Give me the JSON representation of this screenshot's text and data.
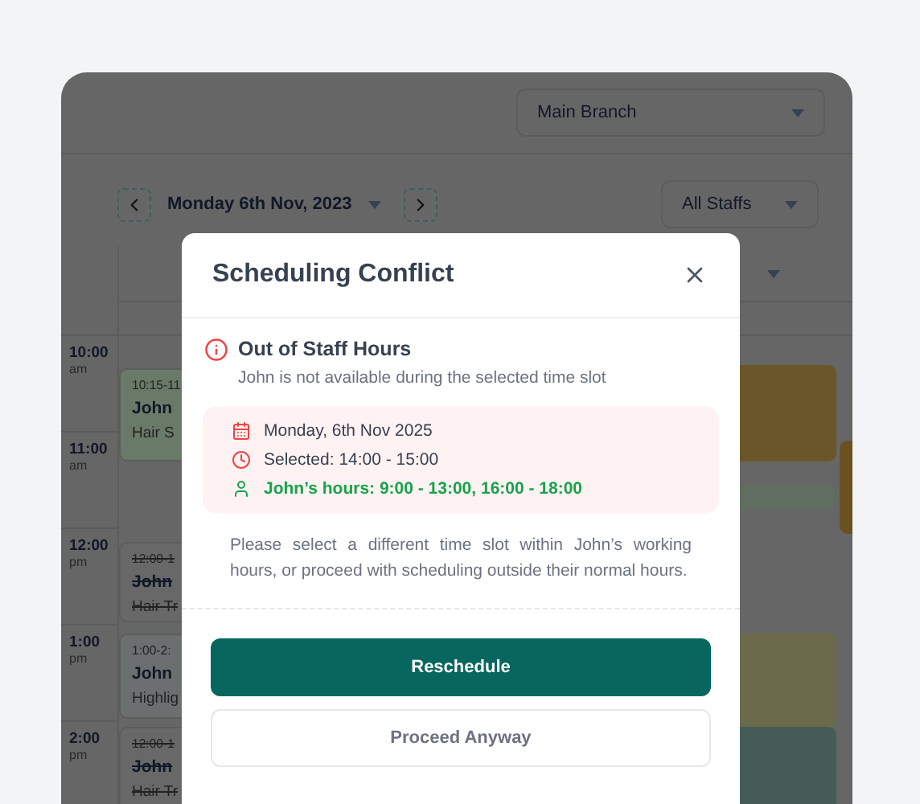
{
  "header": {
    "branch_select": "Main Branch"
  },
  "toolbar": {
    "date": "Monday 6th Nov, 2023",
    "staff_select": "All Staffs"
  },
  "time_slots": [
    {
      "time": "10:00",
      "period": "am"
    },
    {
      "time": "11:00",
      "period": "am"
    },
    {
      "time": "12:00",
      "period": "pm"
    },
    {
      "time": "1:00",
      "period": "pm"
    },
    {
      "time": "2:00",
      "period": "pm"
    }
  ],
  "events": [
    {
      "time": "10:15-11",
      "name": "John",
      "service": "Hair S",
      "cancelled": false,
      "color": "#6a7a68"
    },
    {
      "time": "12:00-1",
      "name": "John",
      "service": "Hair Tr",
      "cancelled": true,
      "color": "#686868"
    },
    {
      "time": "1:00-2:",
      "name": "John",
      "service": "Highlig",
      "cancelled": false,
      "color": "#6b6f70"
    },
    {
      "time": "12:00-1",
      "name": "John",
      "service": "Hair Tr",
      "cancelled": true,
      "color": "#686868"
    }
  ],
  "other_events": [
    {
      "color": "#6a5628"
    },
    {
      "color": "#5f6e60"
    },
    {
      "color": "#6b6a4a"
    },
    {
      "color": "#455b58"
    },
    {
      "color": "#6b5020"
    }
  ],
  "dialog": {
    "title": "Scheduling Conflict",
    "alert": {
      "title": "Out of Staff Hours",
      "message": "John is not available during the selected time slot"
    },
    "details": [
      {
        "kind": "date",
        "text": "Monday, 6th Nov 2025"
      },
      {
        "kind": "time",
        "text": "Selected: 14:00 - 15:00"
      },
      {
        "kind": "hours",
        "text": "John’s hours: 9:00 - 13:00, 16:00 - 18:00"
      }
    ],
    "note": "Please select a different time slot within John’s working hours, or proceed with scheduling outside their normal hours.",
    "primary_button": "Reschedule",
    "secondary_button": "Proceed Anyway"
  }
}
